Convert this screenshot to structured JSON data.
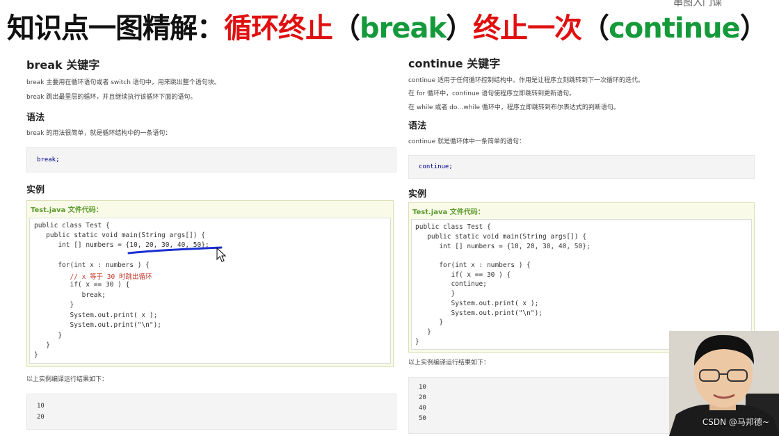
{
  "title": {
    "part1": "知识点一图精解：",
    "part2": "循环终止",
    "part3": "（",
    "part4": "break",
    "part5": "）",
    "part6": "终止一次",
    "part7": "（",
    "part8": "continue",
    "part9": "）"
  },
  "corner_text": "串图入门课",
  "break_section": {
    "heading": "break 关键字",
    "para1": "break 主要用在循环语句或者 switch 语句中，用来跳出整个语句块。",
    "para2": "break 跳出最里层的循环，并且继续执行该循环下面的语句。",
    "syntax_heading": "语法",
    "syntax_desc": "break 的用法很简单，就是循环结构中的一条语句：",
    "syntax_code": "break;",
    "example_heading": "实例",
    "example_label": "Test.java 文件代码：",
    "code_lines": [
      "public class Test {",
      "   public static void main(String args[]) {",
      "      int [] numbers = {10, 20, 30, 40, 50};",
      "",
      "      for(int x : numbers ) {",
      "         // x 等于 30 时跳出循环",
      "         if( x == 30 ) {",
      "            break;",
      "         }",
      "         System.out.print( x );",
      "         System.out.print(\"\\n\");",
      "      }",
      "   }",
      "}"
    ],
    "result_desc": "以上实例编译运行结果如下：",
    "output_lines": [
      "10",
      "20"
    ]
  },
  "continue_section": {
    "heading": "continue 关键字",
    "para1": "continue 适用于任何循环控制结构中。作用是让程序立刻跳转到下一次循环的迭代。",
    "para2": "在 for 循环中，continue 语句使程序立即跳转到更新语句。",
    "para3": "在 while 或者 do…while 循环中，程序立即跳转到布尔表达式的判断语句。",
    "syntax_heading": "语法",
    "syntax_desc": "continue 就是循环体中一条简单的语句：",
    "syntax_code": "continue;",
    "example_heading": "实例",
    "example_label": "Test.java 文件代码：",
    "code_lines": [
      "public class Test {",
      "   public static void main(String args[]) {",
      "      int [] numbers = {10, 20, 30, 40, 50};",
      "",
      "      for(int x : numbers ) {",
      "         if( x == 30 ) {",
      "         continue;",
      "         }",
      "         System.out.print( x );",
      "         System.out.print(\"\\n\");",
      "      }",
      "   }",
      "}"
    ],
    "result_desc": "以上实例编译运行结果如下：",
    "output_lines": [
      "10",
      "20",
      "40",
      "50"
    ]
  },
  "watermark": "CSDN @马邦德~",
  "colors": {
    "title_red": "#e01010",
    "title_green": "#149a3a",
    "example_label_green": "#5b9a2e",
    "annotation_blue": "#1a2fd0"
  }
}
